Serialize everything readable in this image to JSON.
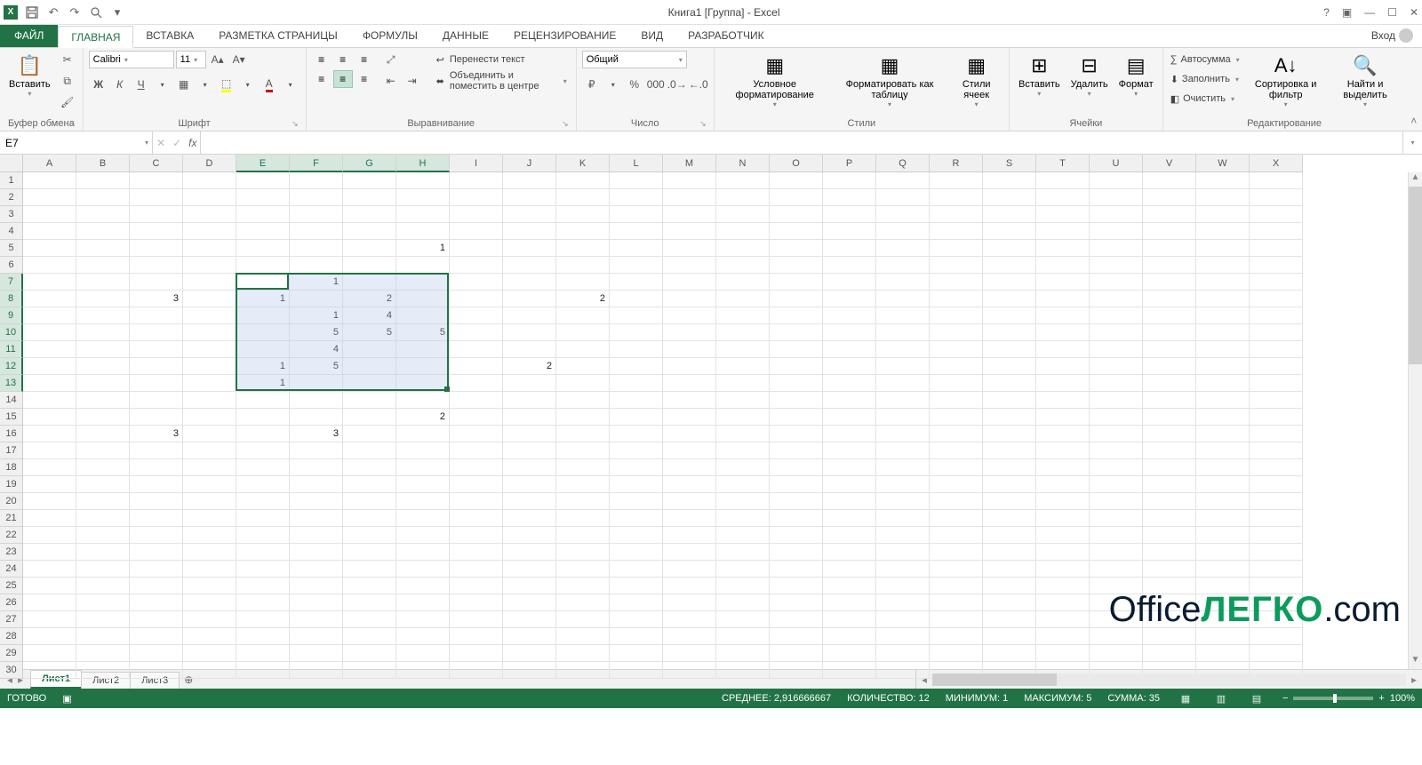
{
  "titlebar": {
    "title": "Книга1  [Группа] - Excel",
    "signin": "Вход"
  },
  "tabs": {
    "file": "ФАЙЛ",
    "items": [
      "ГЛАВНАЯ",
      "ВСТАВКА",
      "РАЗМЕТКА СТРАНИЦЫ",
      "ФОРМУЛЫ",
      "ДАННЫЕ",
      "РЕЦЕНЗИРОВАНИЕ",
      "ВИД",
      "РАЗРАБОТЧИК"
    ]
  },
  "ribbon": {
    "clipboard": {
      "paste": "Вставить",
      "label": "Буфер обмена"
    },
    "font": {
      "name": "Calibri",
      "size": "11",
      "bold": "Ж",
      "italic": "К",
      "underline": "Ч",
      "label": "Шрифт"
    },
    "align": {
      "wrap": "Перенести текст",
      "merge": "Объединить и поместить в центре",
      "label": "Выравнивание"
    },
    "number": {
      "format": "Общий",
      "label": "Число"
    },
    "styles": {
      "cond": "Условное форматирование",
      "table": "Форматировать как таблицу",
      "cell": "Стили ячеек",
      "label": "Стили"
    },
    "cells": {
      "insert": "Вставить",
      "delete": "Удалить",
      "format": "Формат",
      "label": "Ячейки"
    },
    "editing": {
      "autosum": "Автосумма",
      "fill": "Заполнить",
      "clear": "Очистить",
      "sort": "Сортировка и фильтр",
      "find": "Найти и выделить",
      "label": "Редактирование"
    }
  },
  "namebox": "E7",
  "columns": [
    "A",
    "B",
    "C",
    "D",
    "E",
    "F",
    "G",
    "H",
    "I",
    "J",
    "K",
    "L",
    "M",
    "N",
    "O",
    "P",
    "Q",
    "R",
    "S",
    "T",
    "U",
    "V",
    "W",
    "X"
  ],
  "rows": 30,
  "selection": {
    "r1": 7,
    "c1": 5,
    "r2": 13,
    "c2": 8
  },
  "cellData": {
    "5": {
      "8": "1"
    },
    "7": {
      "6": "1"
    },
    "8": {
      "3": "3",
      "5": "1",
      "7": "2",
      "11": "2"
    },
    "9": {
      "6": "1",
      "7": "4"
    },
    "10": {
      "6": "5",
      "7": "5",
      "8": "5"
    },
    "11": {
      "6": "4"
    },
    "12": {
      "5": "1",
      "6": "5",
      "10": "2"
    },
    "13": {
      "5": "1"
    },
    "15": {
      "8": "2"
    },
    "16": {
      "3": "3",
      "6": "3"
    }
  },
  "sheets": [
    "Лист1",
    "Лист2",
    "Лист3"
  ],
  "status": {
    "ready": "ГОТОВО",
    "avg": "СРЕДНЕЕ: 2,916666667",
    "count": "КОЛИЧЕСТВО: 12",
    "min": "МИНИМУМ: 1",
    "max": "МАКСИМУМ: 5",
    "sum": "СУММА: 35",
    "zoom": "100%"
  },
  "watermark": {
    "a": "Office",
    "b": "ЛЕГКО",
    "c": ".com"
  }
}
